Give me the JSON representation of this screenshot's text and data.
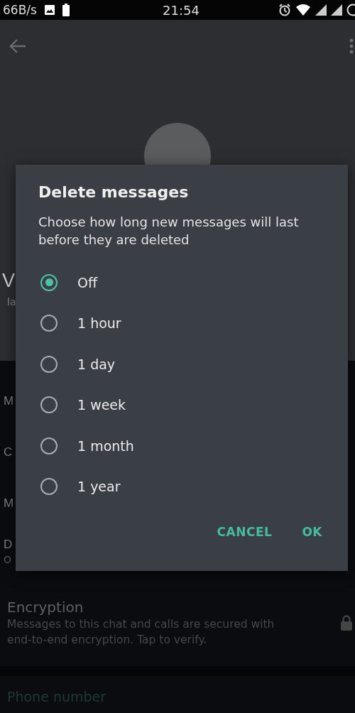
{
  "status_bar": {
    "speed": "66B/s",
    "time": "21:54"
  },
  "profile": {
    "name": "V",
    "subtitle": "la"
  },
  "rows": [
    {
      "title": "M"
    },
    {
      "title": "C"
    },
    {
      "title": "M"
    },
    {
      "title": "D",
      "subtitle": "O"
    }
  ],
  "encryption": {
    "title": "Encryption",
    "description": "Messages to this chat and calls are secured with end-to-end encryption. Tap to verify."
  },
  "phone_section": {
    "title": "Phone number"
  },
  "dialog": {
    "title": "Delete messages",
    "message": "Choose how long new messages will last before they are deleted",
    "options": [
      {
        "label": "Off",
        "selected": true
      },
      {
        "label": "1 hour",
        "selected": false
      },
      {
        "label": "1 day",
        "selected": false
      },
      {
        "label": "1 week",
        "selected": false
      },
      {
        "label": "1 month",
        "selected": false
      },
      {
        "label": "1 year",
        "selected": false
      }
    ],
    "buttons": [
      {
        "label": "CANCEL"
      },
      {
        "label": "OK"
      }
    ]
  }
}
